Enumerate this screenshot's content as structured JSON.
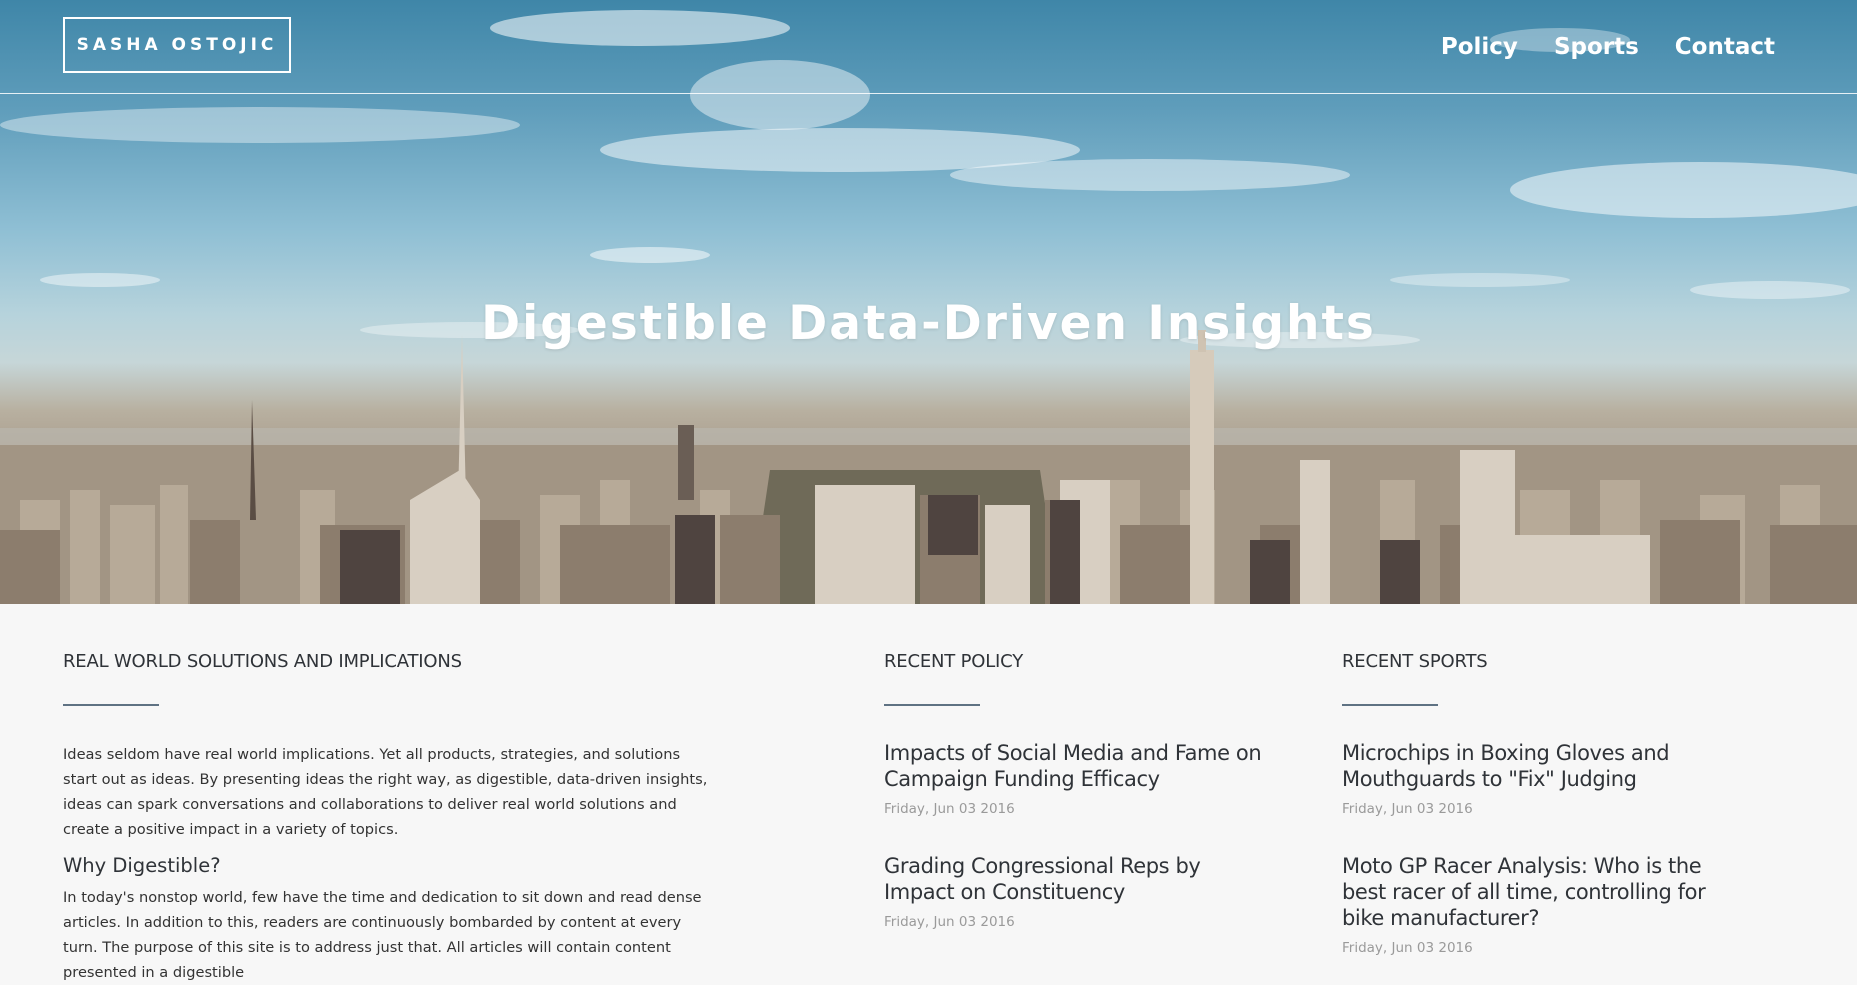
{
  "header": {
    "logo": "SASHA OSTOJIC",
    "nav": [
      {
        "label": "Policy"
      },
      {
        "label": "Sports"
      },
      {
        "label": "Contact"
      }
    ]
  },
  "hero": {
    "title": "Digestible Data-Driven Insights"
  },
  "about": {
    "heading": "REAL WORLD SOLUTIONS AND IMPLICATIONS",
    "paragraph": "Ideas seldom have real world implications. Yet all products, strategies, and solutions start out as ideas. By presenting ideas the right way, as digestible, data-driven insights, ideas can spark conversations and collaborations to deliver real world solutions and create a positive impact in a variety of topics.",
    "subheading": "Why Digestible?",
    "paragraph2": "In today's nonstop world, few have the time and dedication to sit down and read dense articles. In addition to this, readers are continuously bombarded by content at every turn. The purpose of this site is to address just that. All articles will contain content presented in a digestible"
  },
  "policy": {
    "heading": "RECENT POLICY",
    "articles": [
      {
        "title": "Impacts of Social Media and Fame on Campaign Funding Efficacy",
        "date": "Friday, Jun 03 2016"
      },
      {
        "title": "Grading Congressional Reps by Impact on Constituency",
        "date": "Friday, Jun 03 2016"
      }
    ]
  },
  "sports": {
    "heading": "RECENT SPORTS",
    "articles": [
      {
        "title": "Microchips in Boxing Gloves and Mouthguards to \"Fix\" Judging",
        "date": "Friday, Jun 03 2016"
      },
      {
        "title": "Moto GP Racer Analysis: Who is the best racer of all time, controlling for bike manufacturer?",
        "date": "Friday, Jun 03 2016"
      }
    ]
  },
  "colors": {
    "heading_text": "#2f3338",
    "rule": "#5f7283",
    "date_text": "#9a9a9a",
    "content_background": "#f7f7f7"
  }
}
